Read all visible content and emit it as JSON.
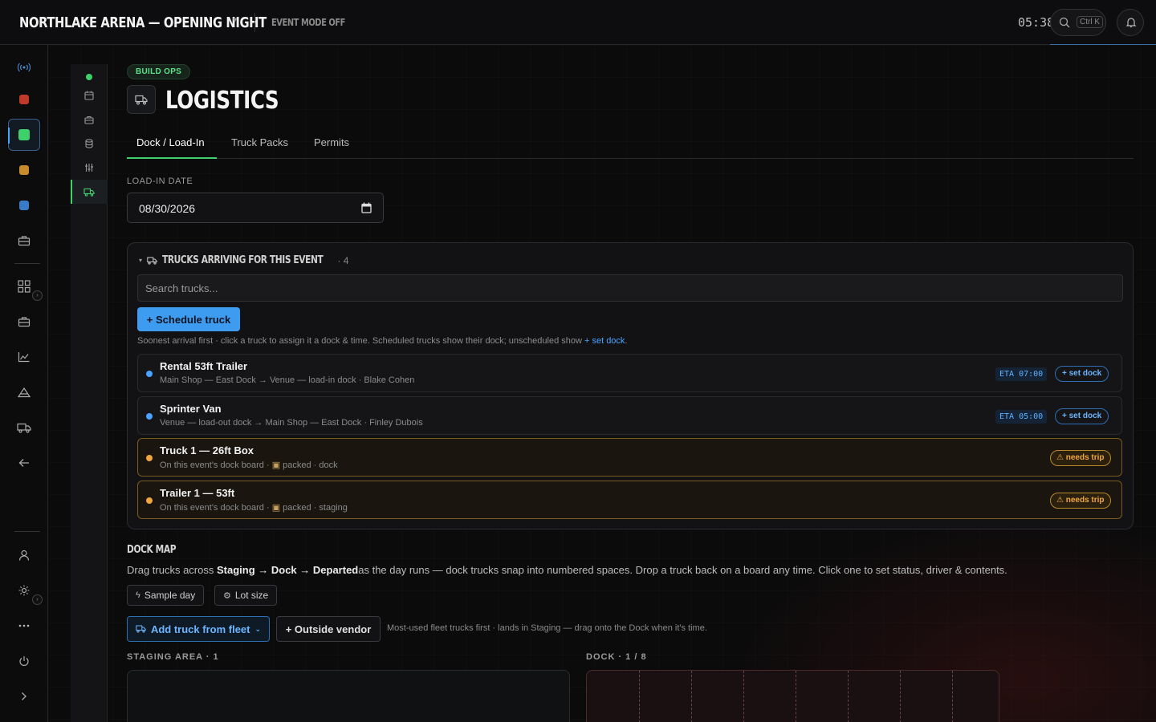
{
  "topbar": {
    "title": "NORTHLAKE ARENA — OPENING NIGHT",
    "event_mode": "EVENT MODE OFF",
    "clock": "05:38",
    "search_shortcut": "Ctrl K"
  },
  "rail": {
    "icons": [
      "broadcast-icon",
      "red-square-icon",
      "green-square-icon",
      "orange-square-icon",
      "blue-square-icon",
      "toolbox-icon",
      "apps-icon",
      "briefcase-icon",
      "chart-icon",
      "tent-icon",
      "truck-icon",
      "arrow-left-icon",
      "user-icon",
      "sun-icon",
      "more-icon",
      "power-icon",
      "chevron-right-icon"
    ],
    "colors": {
      "red": "#c0392b",
      "green": "#3fcf6b",
      "orange": "#c98a2e",
      "blue": "#3a7bc8"
    }
  },
  "page": {
    "badge": "BUILD OPS",
    "title": "LOGISTICS",
    "tabs": [
      {
        "label": "Dock / Load-In",
        "active": true
      },
      {
        "label": "Truck Packs",
        "active": false
      },
      {
        "label": "Permits",
        "active": false
      }
    ]
  },
  "loadin": {
    "label": "LOAD-IN DATE",
    "value": "08/30/2026"
  },
  "trucks_panel": {
    "header": "TRUCKS ARRIVING FOR THIS EVENT",
    "count": "· 4",
    "search_placeholder": "Search trucks...",
    "schedule_button": "+ Schedule truck",
    "hint": "Soonest arrival first · click a truck to assign it a dock & time. Scheduled trucks show their dock; unscheduled show",
    "hint_link": "+ set dock",
    "hint_end": ".",
    "rows": [
      {
        "name": "Rental 53ft Trailer",
        "sub": "Main Shop — East Dock → Venue — load-in dock · Blake Cohen",
        "eta": "ETA 07:00",
        "action": "+ set dock",
        "status": "scheduled",
        "dot_color": "#4aa3ff"
      },
      {
        "name": "Sprinter Van",
        "sub": "Venue — load-out dock → Main Shop — East Dock · Finley Dubois",
        "eta": "ETA 05:00",
        "action": "+ set dock",
        "status": "scheduled",
        "dot_color": "#4aa3ff"
      },
      {
        "name": "Truck 1 — 26ft Box",
        "sub_prefix": "On this event's dock board ·",
        "sub_suffix": "packed · dock",
        "action": "⚠ needs trip",
        "status": "warn",
        "dot_color": "#f0a640"
      },
      {
        "name": "Trailer 1 — 53ft",
        "sub_prefix": "On this event's dock board ·",
        "sub_suffix": "packed · staging",
        "action": "⚠ needs trip",
        "status": "warn",
        "dot_color": "#f0a640"
      }
    ]
  },
  "dockmap": {
    "title": "DOCK MAP",
    "desc_prefix": "Drag trucks across ",
    "desc_bold": "Staging → Dock → Departed",
    "desc_suffix": "as the day runs — dock trucks snap into numbered spaces. Drop a truck back on a board any time. Click one to set status, driver & contents.",
    "sample_day": "Sample day",
    "lot_size": "Lot size",
    "add_fleet": "Add truck from fleet",
    "outside_vendor": "+ Outside vendor",
    "fleet_hint": "Most-used fleet trucks first · lands in Staging — drag onto the Dock when it's time.",
    "staging_label": "STAGING AREA · 1",
    "dock_label": "DOCK · 1 / 8",
    "dock_slots": 8
  }
}
